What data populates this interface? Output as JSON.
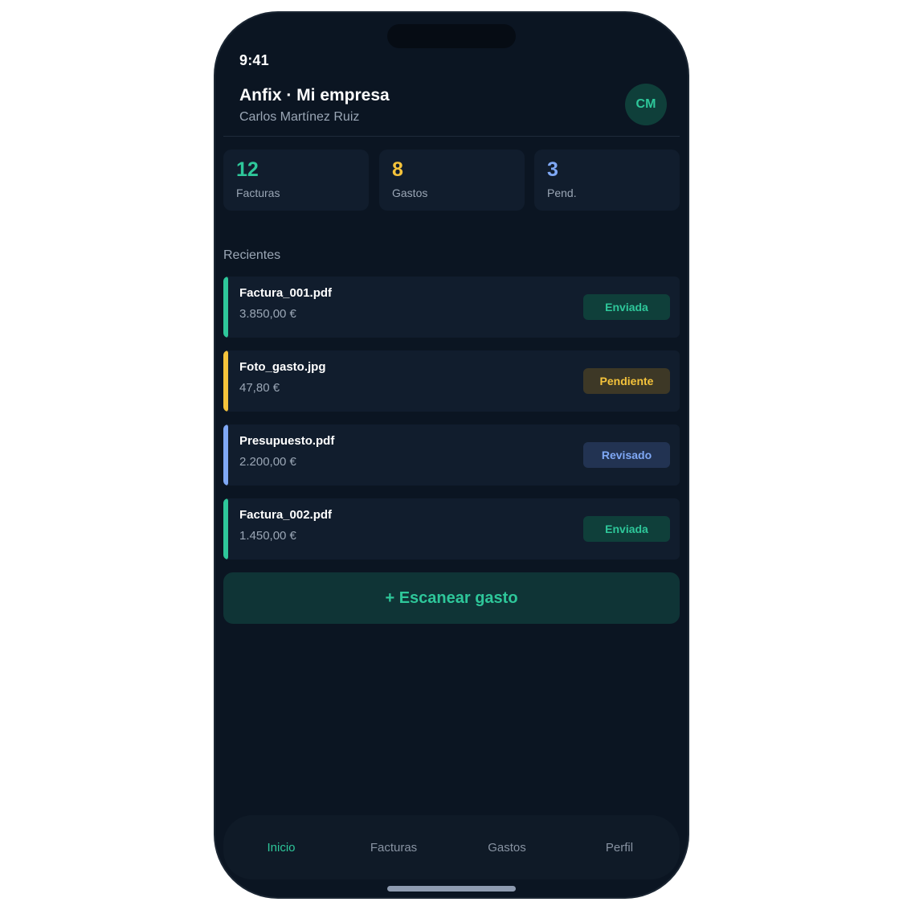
{
  "status_bar": {
    "time": "9:41"
  },
  "header": {
    "title": "Anfix · Mi empresa",
    "user": "Carlos Martínez Ruiz",
    "avatar_initials": "CM"
  },
  "stats": [
    {
      "value": "12",
      "label": "Facturas",
      "color": "#2ec79a"
    },
    {
      "value": "8",
      "label": "Gastos",
      "color": "#f5c33b"
    },
    {
      "value": "3",
      "label": "Pend.",
      "color": "#7fa8f5"
    }
  ],
  "recent": {
    "label": "Recientes",
    "items": [
      {
        "name": "Factura_001.pdf",
        "amount": "3.850,00 €",
        "status": "Enviada",
        "accent": "#2ec79a",
        "badge_bg": "#0f3f3a",
        "badge_fg": "#2ec79a"
      },
      {
        "name": "Foto_gasto.jpg",
        "amount": "47,80 €",
        "status": "Pendiente",
        "accent": "#f5c33b",
        "badge_bg": "#3d3826",
        "badge_fg": "#f5c33b"
      },
      {
        "name": "Presupuesto.pdf",
        "amount": "2.200,00 €",
        "status": "Revisado",
        "accent": "#7fa8f5",
        "badge_bg": "#223352",
        "badge_fg": "#7fa8f5"
      },
      {
        "name": "Factura_002.pdf",
        "amount": "1.450,00 €",
        "status": "Enviada",
        "accent": "#2ec79a",
        "badge_bg": "#0f3f3a",
        "badge_fg": "#2ec79a"
      }
    ]
  },
  "scan_button": {
    "label": "+ Escanear gasto"
  },
  "tabbar": {
    "active": "Inicio",
    "tabs": [
      "Inicio",
      "Facturas",
      "Gastos",
      "Perfil"
    ]
  }
}
